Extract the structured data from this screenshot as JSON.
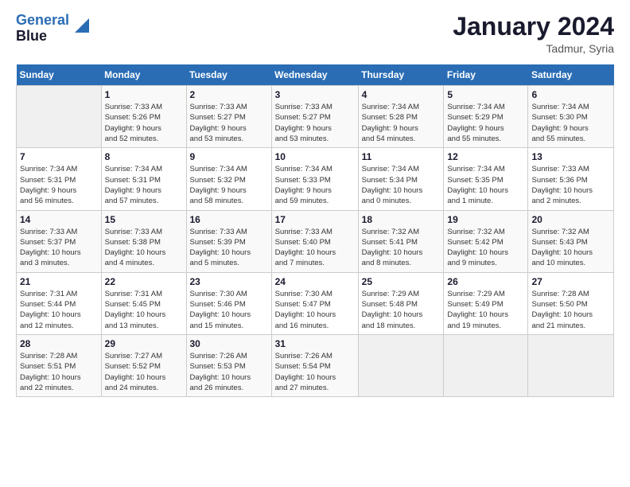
{
  "header": {
    "logo_line1": "General",
    "logo_line2": "Blue",
    "title": "January 2024",
    "location": "Tadmur, Syria"
  },
  "calendar": {
    "days_of_week": [
      "Sunday",
      "Monday",
      "Tuesday",
      "Wednesday",
      "Thursday",
      "Friday",
      "Saturday"
    ],
    "weeks": [
      [
        {
          "day": "",
          "details": ""
        },
        {
          "day": "1",
          "details": "Sunrise: 7:33 AM\nSunset: 5:26 PM\nDaylight: 9 hours\nand 52 minutes."
        },
        {
          "day": "2",
          "details": "Sunrise: 7:33 AM\nSunset: 5:27 PM\nDaylight: 9 hours\nand 53 minutes."
        },
        {
          "day": "3",
          "details": "Sunrise: 7:33 AM\nSunset: 5:27 PM\nDaylight: 9 hours\nand 53 minutes."
        },
        {
          "day": "4",
          "details": "Sunrise: 7:34 AM\nSunset: 5:28 PM\nDaylight: 9 hours\nand 54 minutes."
        },
        {
          "day": "5",
          "details": "Sunrise: 7:34 AM\nSunset: 5:29 PM\nDaylight: 9 hours\nand 55 minutes."
        },
        {
          "day": "6",
          "details": "Sunrise: 7:34 AM\nSunset: 5:30 PM\nDaylight: 9 hours\nand 55 minutes."
        }
      ],
      [
        {
          "day": "7",
          "details": "Sunrise: 7:34 AM\nSunset: 5:31 PM\nDaylight: 9 hours\nand 56 minutes."
        },
        {
          "day": "8",
          "details": "Sunrise: 7:34 AM\nSunset: 5:31 PM\nDaylight: 9 hours\nand 57 minutes."
        },
        {
          "day": "9",
          "details": "Sunrise: 7:34 AM\nSunset: 5:32 PM\nDaylight: 9 hours\nand 58 minutes."
        },
        {
          "day": "10",
          "details": "Sunrise: 7:34 AM\nSunset: 5:33 PM\nDaylight: 9 hours\nand 59 minutes."
        },
        {
          "day": "11",
          "details": "Sunrise: 7:34 AM\nSunset: 5:34 PM\nDaylight: 10 hours\nand 0 minutes."
        },
        {
          "day": "12",
          "details": "Sunrise: 7:34 AM\nSunset: 5:35 PM\nDaylight: 10 hours\nand 1 minute."
        },
        {
          "day": "13",
          "details": "Sunrise: 7:33 AM\nSunset: 5:36 PM\nDaylight: 10 hours\nand 2 minutes."
        }
      ],
      [
        {
          "day": "14",
          "details": "Sunrise: 7:33 AM\nSunset: 5:37 PM\nDaylight: 10 hours\nand 3 minutes."
        },
        {
          "day": "15",
          "details": "Sunrise: 7:33 AM\nSunset: 5:38 PM\nDaylight: 10 hours\nand 4 minutes."
        },
        {
          "day": "16",
          "details": "Sunrise: 7:33 AM\nSunset: 5:39 PM\nDaylight: 10 hours\nand 5 minutes."
        },
        {
          "day": "17",
          "details": "Sunrise: 7:33 AM\nSunset: 5:40 PM\nDaylight: 10 hours\nand 7 minutes."
        },
        {
          "day": "18",
          "details": "Sunrise: 7:32 AM\nSunset: 5:41 PM\nDaylight: 10 hours\nand 8 minutes."
        },
        {
          "day": "19",
          "details": "Sunrise: 7:32 AM\nSunset: 5:42 PM\nDaylight: 10 hours\nand 9 minutes."
        },
        {
          "day": "20",
          "details": "Sunrise: 7:32 AM\nSunset: 5:43 PM\nDaylight: 10 hours\nand 10 minutes."
        }
      ],
      [
        {
          "day": "21",
          "details": "Sunrise: 7:31 AM\nSunset: 5:44 PM\nDaylight: 10 hours\nand 12 minutes."
        },
        {
          "day": "22",
          "details": "Sunrise: 7:31 AM\nSunset: 5:45 PM\nDaylight: 10 hours\nand 13 minutes."
        },
        {
          "day": "23",
          "details": "Sunrise: 7:30 AM\nSunset: 5:46 PM\nDaylight: 10 hours\nand 15 minutes."
        },
        {
          "day": "24",
          "details": "Sunrise: 7:30 AM\nSunset: 5:47 PM\nDaylight: 10 hours\nand 16 minutes."
        },
        {
          "day": "25",
          "details": "Sunrise: 7:29 AM\nSunset: 5:48 PM\nDaylight: 10 hours\nand 18 minutes."
        },
        {
          "day": "26",
          "details": "Sunrise: 7:29 AM\nSunset: 5:49 PM\nDaylight: 10 hours\nand 19 minutes."
        },
        {
          "day": "27",
          "details": "Sunrise: 7:28 AM\nSunset: 5:50 PM\nDaylight: 10 hours\nand 21 minutes."
        }
      ],
      [
        {
          "day": "28",
          "details": "Sunrise: 7:28 AM\nSunset: 5:51 PM\nDaylight: 10 hours\nand 22 minutes."
        },
        {
          "day": "29",
          "details": "Sunrise: 7:27 AM\nSunset: 5:52 PM\nDaylight: 10 hours\nand 24 minutes."
        },
        {
          "day": "30",
          "details": "Sunrise: 7:26 AM\nSunset: 5:53 PM\nDaylight: 10 hours\nand 26 minutes."
        },
        {
          "day": "31",
          "details": "Sunrise: 7:26 AM\nSunset: 5:54 PM\nDaylight: 10 hours\nand 27 minutes."
        },
        {
          "day": "",
          "details": ""
        },
        {
          "day": "",
          "details": ""
        },
        {
          "day": "",
          "details": ""
        }
      ]
    ]
  }
}
